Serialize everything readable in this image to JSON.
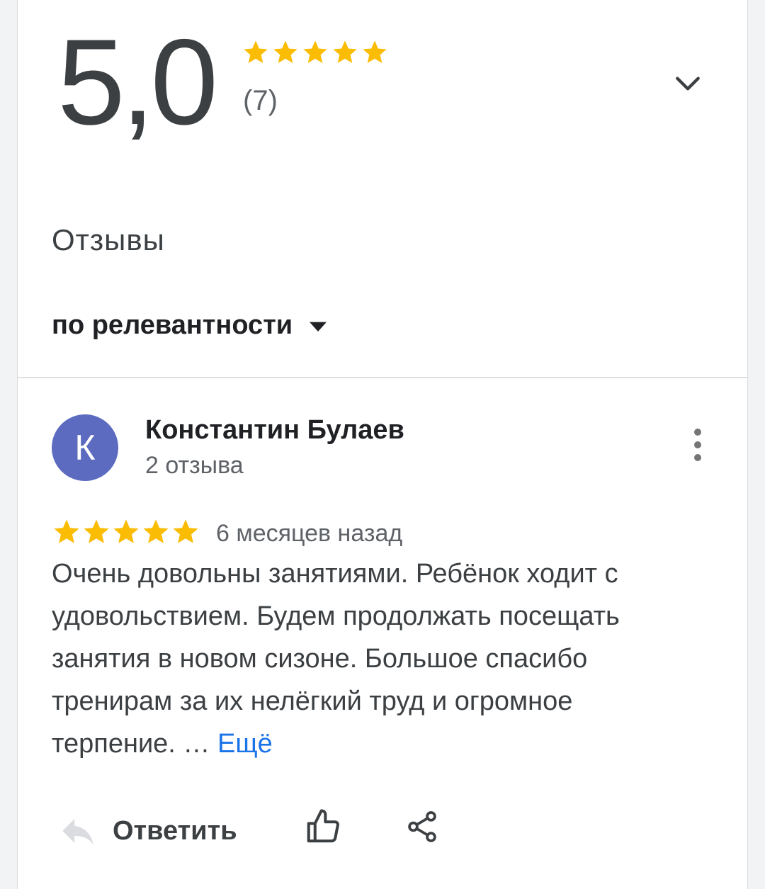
{
  "summary": {
    "rating": "5,0",
    "stars": 5,
    "review_count": "(7)"
  },
  "section_title": "Отзывы",
  "sort": {
    "label": "по релевантности"
  },
  "review": {
    "avatar_letter": "К",
    "author": "Константин Булаев",
    "author_reviews": "2 отзыва",
    "stars": 5,
    "date": "6 месяцев назад",
    "text": "Очень довольны занятиями. Ребёнок ходит с удовольствием. Будем продолжать посещать занятия в новом сизоне. Большое спасибо тренирам за их нелёгкий труд и огромное терпение. … ",
    "more_link": "Ещё"
  },
  "actions": {
    "reply_label": "Ответить"
  },
  "icons": {
    "star": "star-icon",
    "chevron": "chevron-down-icon",
    "caret": "dropdown-caret-icon",
    "more": "more-vert-icon",
    "reply": "reply-icon",
    "like": "thumb-up-icon",
    "share": "share-icon"
  },
  "colors": {
    "star": "#fbbc04",
    "avatar": "#5c6bc0",
    "link": "#1a73e8"
  }
}
